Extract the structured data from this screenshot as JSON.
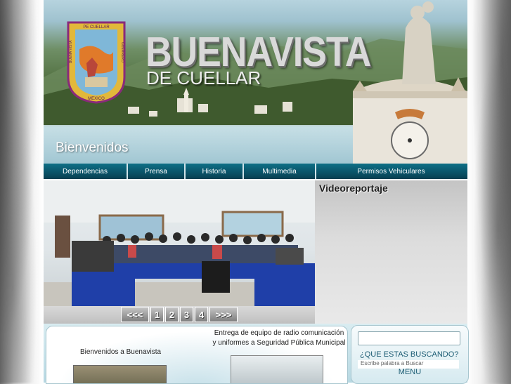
{
  "header": {
    "title": "BUENAVISTA",
    "subtitle": "DE CUELLAR",
    "welcome": "Bienvenidos",
    "crest": {
      "text_top": "PE CUELLAR",
      "text_left": "BUENA VISTA",
      "text_right": "GUERRERO",
      "text_bottom": "MEXICO"
    }
  },
  "nav": {
    "items": [
      {
        "label": "Dependencias"
      },
      {
        "label": "Prensa"
      },
      {
        "label": "Historia"
      },
      {
        "label": "Multimedia"
      },
      {
        "label": "Permisos Vehiculares"
      }
    ]
  },
  "slideshow": {
    "pager": [
      "<<<",
      "1",
      "2",
      "3",
      "4",
      ">>>"
    ]
  },
  "video": {
    "title": "Videoreportaje"
  },
  "news": {
    "left_heading": "Bienvenidos a Buenavista",
    "right_heading": "Entrega de equipo de radio comunicación y uniformes a Seguridad Pública Municipal"
  },
  "search": {
    "label": "¿QUE ESTAS BUSCANDO?",
    "hint": "Escribe palabra a Buscar",
    "menu_label": "MENU"
  },
  "colors": {
    "nav_bg": "#0a5267",
    "accent": "#1b5c73"
  }
}
